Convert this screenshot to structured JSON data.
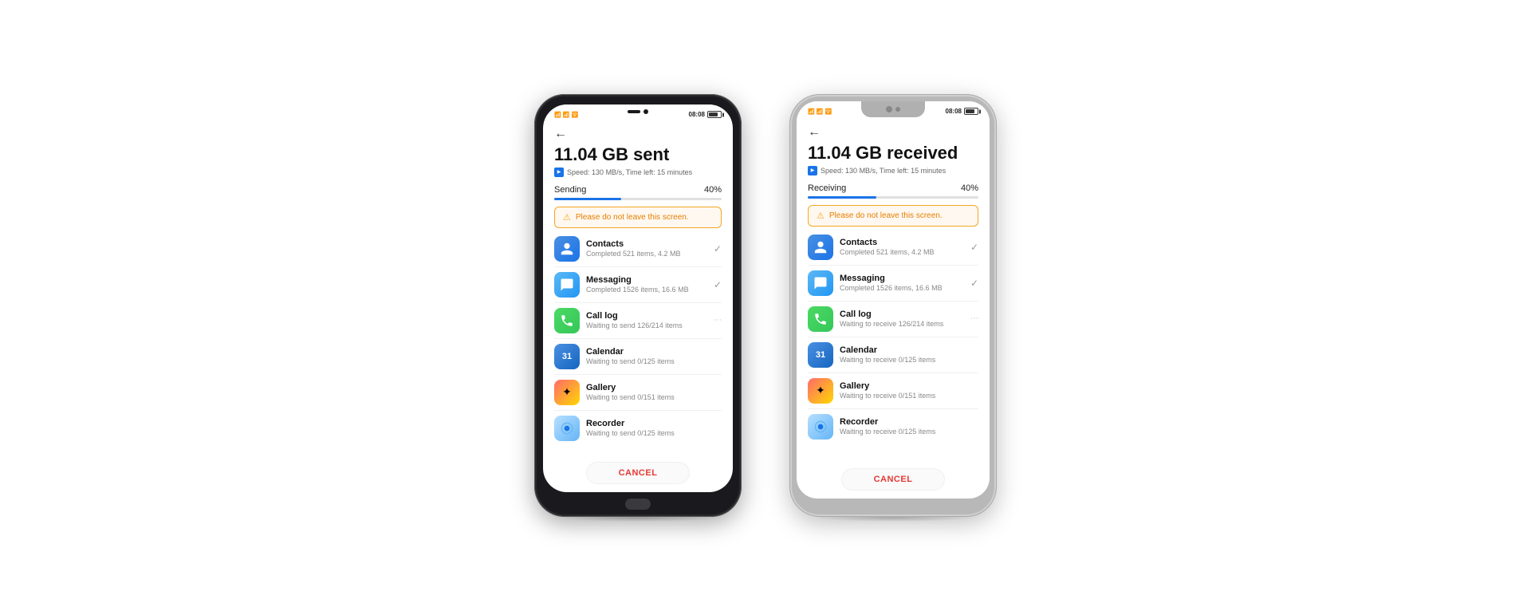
{
  "phone1": {
    "status_bar": {
      "signal": "📶📶📶",
      "wifi": "🛜",
      "time": "08:08"
    },
    "title": "11.04 GB sent",
    "speed_label": "Speed:",
    "speed_value": "130 MB/s, Time left: 15 minutes",
    "progress_label": "Sending",
    "progress_percent": "40%",
    "progress_value": 40,
    "warning_text": "Please do not leave this screen.",
    "back_arrow": "←",
    "items": [
      {
        "name": "Contacts",
        "status": "Completed 521 items, 4.2 MB",
        "state": "done",
        "icon_type": "contacts"
      },
      {
        "name": "Messaging",
        "status": "Completed 1526 items, 16.6 MB",
        "state": "done",
        "icon_type": "messaging"
      },
      {
        "name": "Call log",
        "status": "Waiting to send 126/214 items",
        "state": "spinning",
        "icon_type": "calllog"
      },
      {
        "name": "Calendar",
        "status": "Waiting to send  0/125 items",
        "state": "none",
        "icon_type": "calendar"
      },
      {
        "name": "Gallery",
        "status": "Waiting to send  0/151 items",
        "state": "none",
        "icon_type": "gallery"
      },
      {
        "name": "Recorder",
        "status": "Waiting to send  0/125 items",
        "state": "none",
        "icon_type": "recorder"
      }
    ],
    "cancel_label": "CANCEL"
  },
  "phone2": {
    "status_bar": {
      "signal": "📶📶📶",
      "wifi": "🛜",
      "time": "08:08"
    },
    "title": "11.04 GB received",
    "speed_label": "Speed:",
    "speed_value": "130 MB/s, Time left: 15 minutes",
    "progress_label": "Receiving",
    "progress_percent": "40%",
    "progress_value": 40,
    "warning_text": "Please do not leave this screen.",
    "back_arrow": "←",
    "items": [
      {
        "name": "Contacts",
        "status": "Completed 521 items, 4.2 MB",
        "state": "done",
        "icon_type": "contacts"
      },
      {
        "name": "Messaging",
        "status": "Completed 1526 items, 16.6 MB",
        "state": "done",
        "icon_type": "messaging"
      },
      {
        "name": "Call log",
        "status": "Waiting to receive 126/214 items",
        "state": "spinning",
        "icon_type": "calllog"
      },
      {
        "name": "Calendar",
        "status": "Waiting to receive 0/125 items",
        "state": "none",
        "icon_type": "calendar"
      },
      {
        "name": "Gallery",
        "status": "Waiting to receive 0/151 items",
        "state": "none",
        "icon_type": "gallery"
      },
      {
        "name": "Recorder",
        "status": "Waiting to receive 0/125 items",
        "state": "none",
        "icon_type": "recorder"
      }
    ],
    "cancel_label": "CANCEL"
  },
  "colors": {
    "progress_fill": "#1a73e8",
    "warning_bg": "#fff8f0",
    "warning_border": "#f5a623",
    "warning_text": "#e67e00",
    "cancel_text": "#e53935"
  }
}
